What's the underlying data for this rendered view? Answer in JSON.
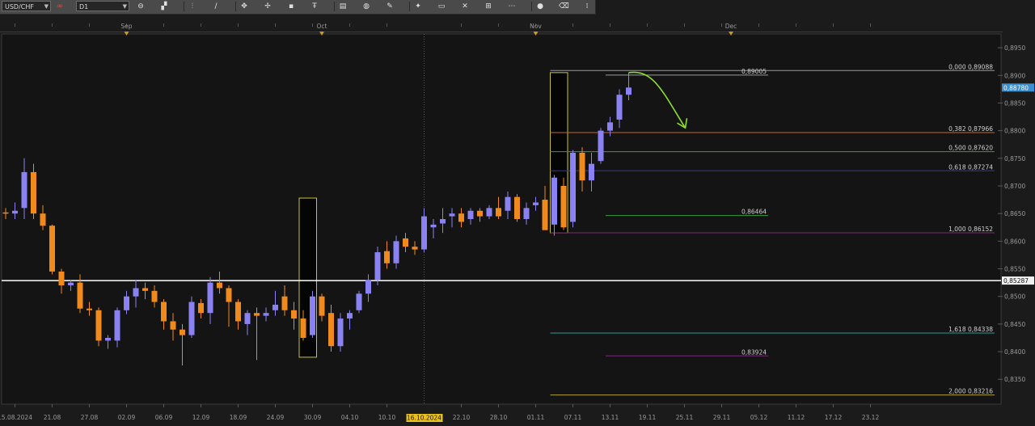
{
  "toolbar": {
    "symbol": "USD/CHF",
    "timeframe": "D1",
    "tools": [
      {
        "name": "zoom-icon",
        "glyph": "⊖"
      },
      {
        "name": "chart-type-icon",
        "glyph": "▞"
      },
      {
        "name": "indicators-icon",
        "glyph": "⫶"
      },
      {
        "name": "line-tool-icon",
        "glyph": "∕"
      },
      {
        "name": "pointer-icon",
        "glyph": "✥"
      },
      {
        "name": "crosshair-icon",
        "glyph": "✢"
      },
      {
        "name": "shape-icon",
        "glyph": "▪"
      },
      {
        "name": "text-tool-icon",
        "glyph": "Ŧ"
      },
      {
        "name": "note-icon",
        "glyph": "▤"
      },
      {
        "name": "globe-icon",
        "glyph": "◍"
      },
      {
        "name": "pencil-icon",
        "glyph": "✎"
      },
      {
        "name": "trend-icon",
        "glyph": "✦"
      },
      {
        "name": "window-icon",
        "glyph": "▭"
      },
      {
        "name": "delete-icon",
        "glyph": "✕"
      },
      {
        "name": "grid-icon",
        "glyph": "⊞"
      },
      {
        "name": "fibonacci-icon",
        "glyph": "⋯"
      },
      {
        "name": "circle-icon",
        "glyph": "●"
      },
      {
        "name": "eraser-icon",
        "glyph": "⌫"
      },
      {
        "name": "more-icon",
        "glyph": "⁞"
      }
    ]
  },
  "month_labels": [
    {
      "label": "Sep",
      "date": "2024-09-02"
    },
    {
      "label": "Oct",
      "date": "2024-10-01"
    },
    {
      "label": "Nov",
      "date": "2024-11-01"
    },
    {
      "label": "Dec",
      "date": "2024-12-02"
    }
  ],
  "chart_data": {
    "type": "candlestick",
    "symbol": "USD/CHF",
    "timeframe": "D1",
    "ylim": [
      0.8305,
      0.8975
    ],
    "y_ticks": [
      "0,8950",
      "0,8900",
      "0,8850",
      "0,8800",
      "0,8750",
      "0,8700",
      "0,8650",
      "0,8600",
      "0,8550",
      "0,8500",
      "0,8450",
      "0,8400",
      "0,8350"
    ],
    "y_tick_values": [
      0.895,
      0.89,
      0.885,
      0.88,
      0.875,
      0.87,
      0.865,
      0.86,
      0.855,
      0.85,
      0.845,
      0.84,
      0.835
    ],
    "x_ticks": [
      {
        "label": "15.08.2024",
        "i": 1
      },
      {
        "label": "21.08",
        "i": 5
      },
      {
        "label": "27.08",
        "i": 9
      },
      {
        "label": "02.09",
        "i": 13
      },
      {
        "label": "06.09",
        "i": 17
      },
      {
        "label": "12.09",
        "i": 21
      },
      {
        "label": "18.09",
        "i": 25
      },
      {
        "label": "24.09",
        "i": 29
      },
      {
        "label": "30.09",
        "i": 33
      },
      {
        "label": "04.10",
        "i": 37
      },
      {
        "label": "10.10",
        "i": 41
      },
      {
        "label": "22.10",
        "i": 49
      },
      {
        "label": "28.10",
        "i": 53
      },
      {
        "label": "01.11",
        "i": 57
      },
      {
        "label": "07.11",
        "i": 61
      },
      {
        "label": "13.11",
        "i": 65
      },
      {
        "label": "19.11",
        "i": 69
      },
      {
        "label": "25.11",
        "i": 73
      },
      {
        "label": "29.11",
        "i": 77
      },
      {
        "label": "05.12",
        "i": 81
      },
      {
        "label": "11.12",
        "i": 85
      },
      {
        "label": "17.12",
        "i": 89
      },
      {
        "label": "23.12",
        "i": 93
      }
    ],
    "crosshair_date": "16.10.2024",
    "crosshair_index": 45,
    "current_price": "0,88780",
    "current_price_value": 0.8878,
    "hline_price": "0,85287",
    "hline_value": 0.85287,
    "candles": [
      [
        0.8652,
        0.866,
        0.864,
        0.865
      ],
      [
        0.865,
        0.867,
        0.864,
        0.8655
      ],
      [
        0.866,
        0.875,
        0.864,
        0.8725
      ],
      [
        0.8725,
        0.874,
        0.864,
        0.865
      ],
      [
        0.865,
        0.8665,
        0.862,
        0.8628
      ],
      [
        0.8628,
        0.863,
        0.854,
        0.8545
      ],
      [
        0.8545,
        0.855,
        0.8505,
        0.852
      ],
      [
        0.852,
        0.853,
        0.851,
        0.8525
      ],
      [
        0.8525,
        0.854,
        0.847,
        0.8478
      ],
      [
        0.8478,
        0.849,
        0.8465,
        0.8475
      ],
      [
        0.8475,
        0.848,
        0.841,
        0.842
      ],
      [
        0.842,
        0.843,
        0.8405,
        0.8425
      ],
      [
        0.842,
        0.848,
        0.8408,
        0.8475
      ],
      [
        0.8475,
        0.851,
        0.8468,
        0.85
      ],
      [
        0.85,
        0.853,
        0.848,
        0.8515
      ],
      [
        0.8515,
        0.8525,
        0.8495,
        0.851
      ],
      [
        0.851,
        0.852,
        0.848,
        0.849
      ],
      [
        0.849,
        0.8495,
        0.844,
        0.8455
      ],
      [
        0.8455,
        0.847,
        0.842,
        0.844
      ],
      [
        0.844,
        0.845,
        0.8375,
        0.843
      ],
      [
        0.843,
        0.85,
        0.8425,
        0.849
      ],
      [
        0.8488,
        0.8495,
        0.846,
        0.847
      ],
      [
        0.847,
        0.8535,
        0.845,
        0.8525
      ],
      [
        0.8525,
        0.8545,
        0.8505,
        0.8515
      ],
      [
        0.8515,
        0.852,
        0.8445,
        0.849
      ],
      [
        0.849,
        0.8495,
        0.844,
        0.8455
      ],
      [
        0.845,
        0.8475,
        0.843,
        0.847
      ],
      [
        0.847,
        0.848,
        0.8385,
        0.8465
      ],
      [
        0.8465,
        0.848,
        0.8455,
        0.847
      ],
      [
        0.8475,
        0.851,
        0.8465,
        0.8485
      ],
      [
        0.85,
        0.852,
        0.8465,
        0.8475
      ],
      [
        0.8475,
        0.849,
        0.844,
        0.846
      ],
      [
        0.846,
        0.8475,
        0.842,
        0.8425
      ],
      [
        0.843,
        0.851,
        0.8425,
        0.85
      ],
      [
        0.85,
        0.8505,
        0.8455,
        0.8465
      ],
      [
        0.847,
        0.8485,
        0.84,
        0.841
      ],
      [
        0.841,
        0.847,
        0.84,
        0.846
      ],
      [
        0.846,
        0.8475,
        0.844,
        0.847
      ],
      [
        0.8475,
        0.851,
        0.847,
        0.8505
      ],
      [
        0.8505,
        0.854,
        0.849,
        0.853
      ],
      [
        0.853,
        0.859,
        0.852,
        0.858
      ],
      [
        0.8582,
        0.86,
        0.855,
        0.856
      ],
      [
        0.856,
        0.861,
        0.855,
        0.86
      ],
      [
        0.8605,
        0.8615,
        0.858,
        0.859
      ],
      [
        0.859,
        0.86,
        0.8575,
        0.8585
      ],
      [
        0.8585,
        0.866,
        0.858,
        0.8645
      ],
      [
        0.8625,
        0.864,
        0.8605,
        0.863
      ],
      [
        0.8632,
        0.866,
        0.8615,
        0.864
      ],
      [
        0.8645,
        0.866,
        0.8625,
        0.865
      ],
      [
        0.865,
        0.866,
        0.8625,
        0.8635
      ],
      [
        0.864,
        0.866,
        0.863,
        0.8655
      ],
      [
        0.8655,
        0.866,
        0.8635,
        0.8645
      ],
      [
        0.8645,
        0.8665,
        0.864,
        0.866
      ],
      [
        0.866,
        0.868,
        0.864,
        0.8645
      ],
      [
        0.8655,
        0.869,
        0.864,
        0.868
      ],
      [
        0.868,
        0.8685,
        0.8635,
        0.864
      ],
      [
        0.864,
        0.867,
        0.863,
        0.866
      ],
      [
        0.8665,
        0.868,
        0.8655,
        0.867
      ],
      [
        0.8675,
        0.87,
        0.8625,
        0.862
      ],
      [
        0.863,
        0.872,
        0.861,
        0.8715
      ],
      [
        0.87,
        0.8715,
        0.862,
        0.8625
      ],
      [
        0.8635,
        0.8765,
        0.8625,
        0.876
      ],
      [
        0.876,
        0.877,
        0.869,
        0.871
      ],
      [
        0.871,
        0.876,
        0.869,
        0.874
      ],
      [
        0.8745,
        0.8805,
        0.874,
        0.88
      ],
      [
        0.88,
        0.8825,
        0.879,
        0.8815
      ],
      [
        0.882,
        0.8875,
        0.8805,
        0.8865
      ],
      [
        0.8865,
        0.8905,
        0.8855,
        0.8878
      ]
    ],
    "fib_levels": [
      {
        "label": "0,000 0,89088",
        "value": 0.89088,
        "color": "#9a9a9a"
      },
      {
        "label": "0,382 0,87966",
        "value": 0.87966,
        "color": "#c06828"
      },
      {
        "label": "0,500 0,87620",
        "value": 0.8762,
        "color": "#34a040"
      },
      {
        "label": "0,618 0,87274",
        "value": 0.87274,
        "color": "#2a3aa8"
      },
      {
        "label": "1,000 0,86152",
        "value": 0.86152,
        "color": "#7a2a7a"
      },
      {
        "label": "1,618 0,84338",
        "value": 0.84338,
        "color": "#2a9a9a"
      },
      {
        "label": "2,000 0,83216",
        "value": 0.83216,
        "color": "#b0a030"
      }
    ],
    "short_levels": [
      {
        "label": "0,89005",
        "value": 0.89005,
        "color": "#9a9a9a"
      },
      {
        "label": "0,86464",
        "value": 0.86464,
        "color": "#34a040"
      },
      {
        "label": "0,83924",
        "value": 0.83924,
        "color": "#7a2a7a"
      }
    ],
    "highlight_boxes": [
      {
        "from": 32,
        "to": 33,
        "top": 0.8678,
        "bottom": 0.839
      },
      {
        "from": 59,
        "to": 60,
        "top": 0.8905,
        "bottom": 0.8615
      }
    ],
    "colors": {
      "bull": "#8a82f2",
      "bear": "#f08a1c",
      "wick": "#b07a40",
      "hline": "#ffffff",
      "annotation": "#8ddf2a",
      "box": "#c8c040",
      "price_marker": "#3a8fd0"
    }
  }
}
